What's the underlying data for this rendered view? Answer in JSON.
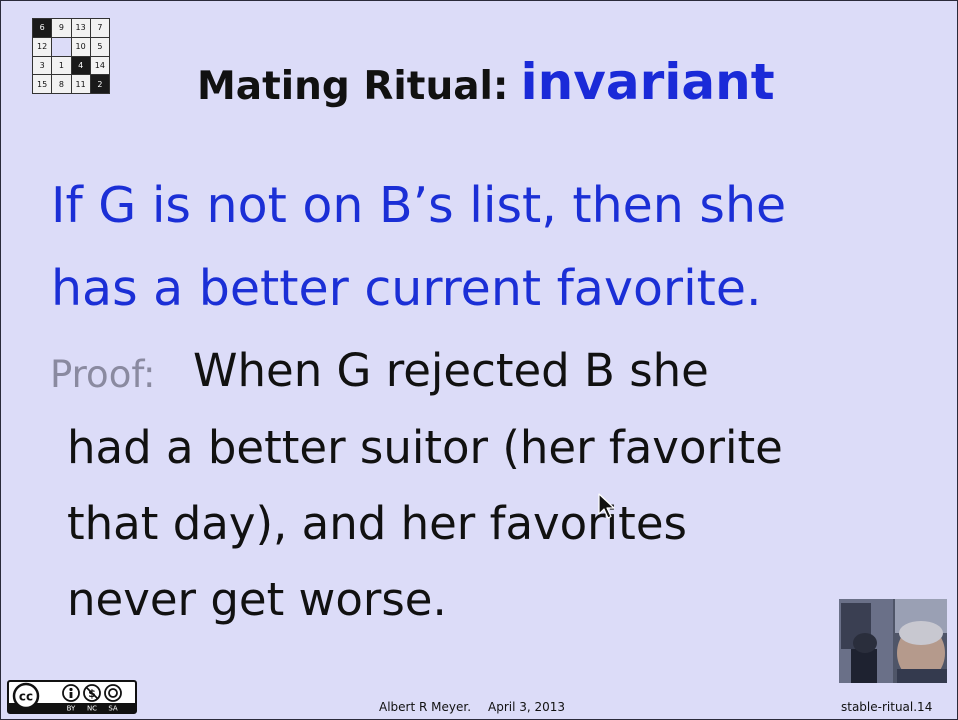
{
  "puzzle": {
    "tiles": [
      "6",
      "9",
      "13",
      "7",
      "12",
      "",
      "10",
      "5",
      "3",
      "1",
      "4",
      "14",
      "15",
      "8",
      "11",
      "2"
    ]
  },
  "title": {
    "prefix": "Mating Ritual:",
    "highlight": "invariant"
  },
  "claim": {
    "line1": "If G is not on B’s list, then she",
    "line2": "has a better current favorite."
  },
  "proof": {
    "label": "Proof:",
    "line1": "When G rejected B she",
    "line2": "had a better suitor (her favorite",
    "line3": "that day), and her favorites",
    "line4": "never get worse."
  },
  "license": {
    "labels": [
      "BY",
      "NC",
      "SA"
    ]
  },
  "footer": {
    "author": "Albert R Meyer.",
    "date": "April 3, 2013",
    "slide_id": "stable-ritual.14"
  },
  "colors": {
    "background": "#dcdcf8",
    "title_blue": "#1a2ad8",
    "claim_blue": "#1b2fd6",
    "proof_label_gray": "#8a8aa0"
  },
  "icons": [
    "fifteen-puzzle-logo",
    "mouse-cursor-icon",
    "creative-commons-icon",
    "attribution-icon",
    "noncommercial-icon",
    "sharealike-icon"
  ]
}
